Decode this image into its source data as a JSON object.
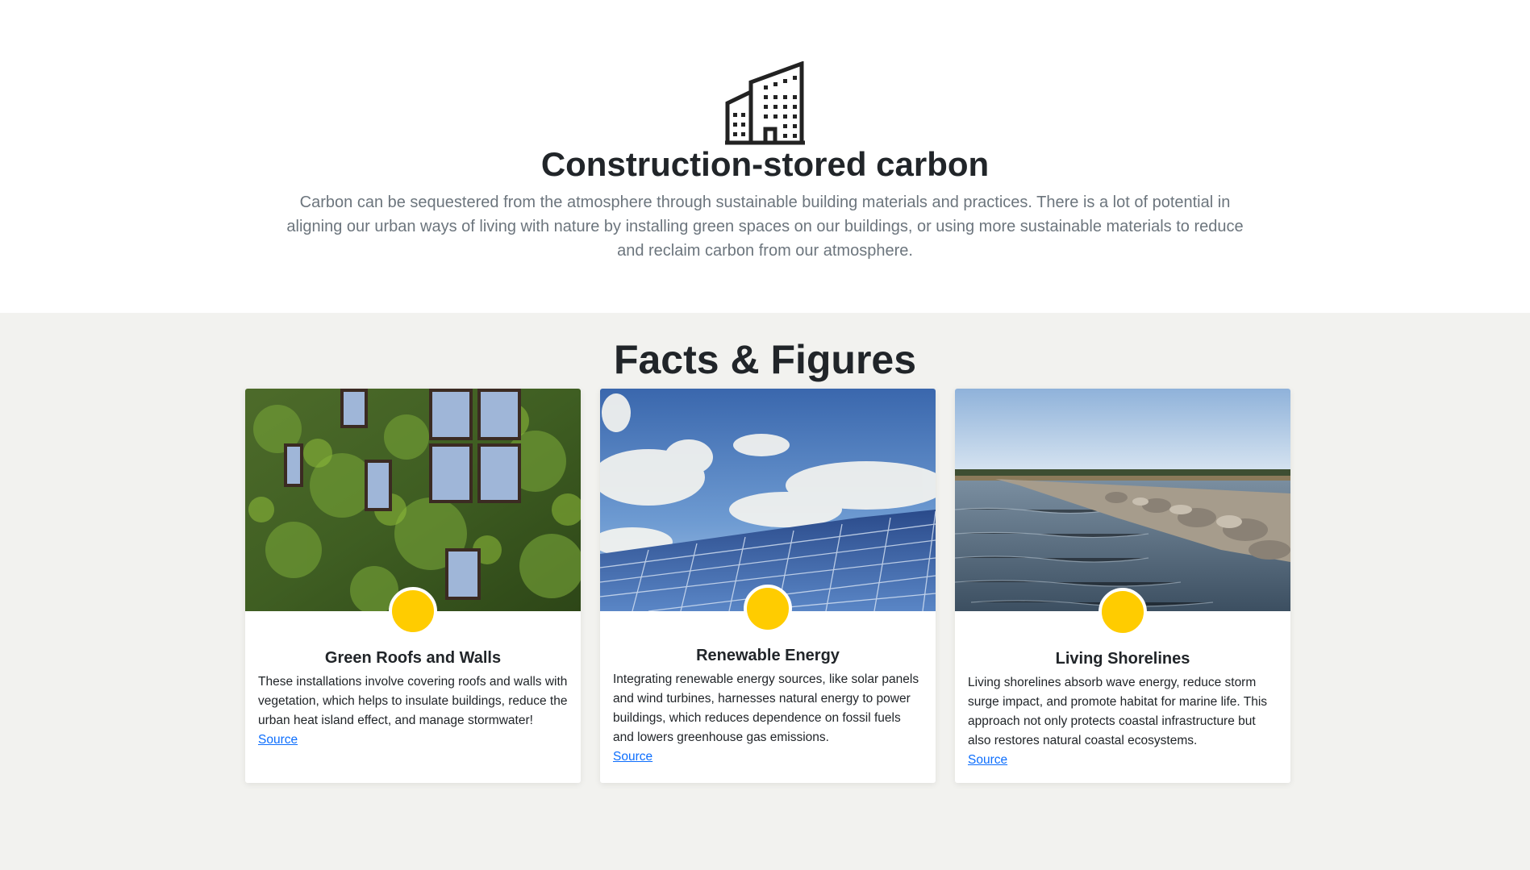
{
  "hero": {
    "icon": "building-icon",
    "title": "Construction-stored carbon",
    "description": "Carbon can be sequestered from the atmosphere through sustainable building materials and practices. There is a lot of potential in aligning our urban ways of living with nature by installing green spaces on our buildings, or using more sustainable materials to reduce and reclaim carbon from our atmosphere."
  },
  "facts": {
    "title": "Facts & Figures",
    "accent_color": "#ffcc00",
    "cards": [
      {
        "image": "green-wall-photo",
        "title": "Green Roofs and Walls",
        "text": "These installations involve covering roofs and walls with vegetation, which helps to insulate buildings, reduce the urban heat island effect, and manage stormwater!",
        "link": "Source"
      },
      {
        "image": "solar-panel-photo",
        "title": "Renewable Energy",
        "text": "Integrating renewable energy sources, like solar panels and wind turbines, harnesses natural energy to power buildings, which reduces dependence on fossil fuels and lowers greenhouse gas emissions.",
        "link": "Source"
      },
      {
        "image": "shoreline-photo",
        "title": "Living Shorelines",
        "text": "Living shorelines absorb wave energy, reduce storm surge impact, and promote habitat for marine life. This approach not only protects coastal infrastructure but also restores natural coastal ecosystems.",
        "link": "Source"
      }
    ]
  }
}
